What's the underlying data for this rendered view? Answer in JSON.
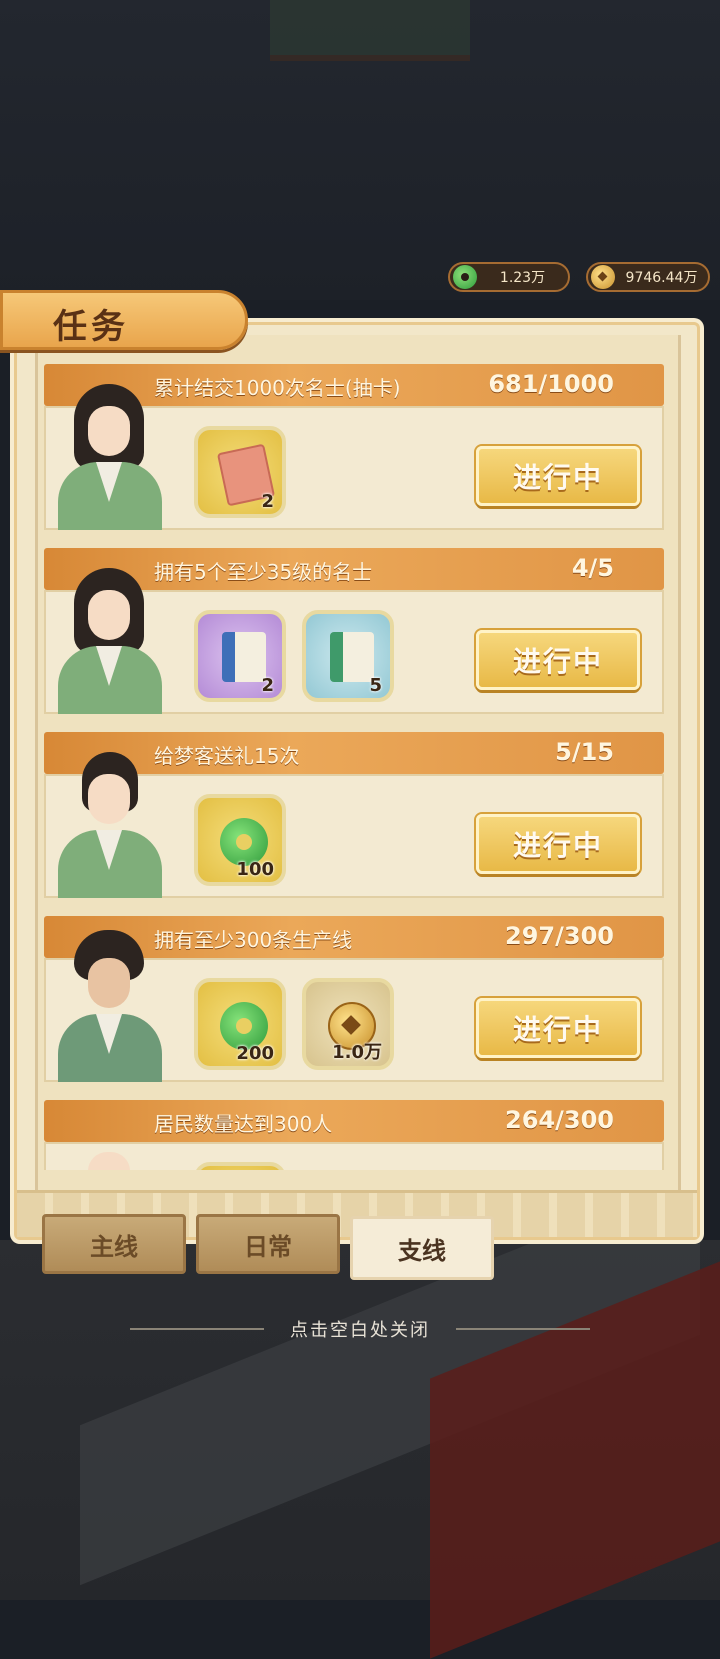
{
  "currency": {
    "jade_icon": "jade-currency-icon",
    "jade_amount": "1.23万",
    "coin_icon": "copper-coin-icon",
    "coin_amount": "9746.44万"
  },
  "panel": {
    "title": "任务"
  },
  "tasks": [
    {
      "name": "累计结交1000次名士(抽卡)",
      "progress": "681/1000",
      "rewards": [
        {
          "icon": "recruit-card-icon",
          "qty": "2"
        }
      ],
      "button": "进行中"
    },
    {
      "name": "拥有5个至少35级的名士",
      "progress": "4/5",
      "rewards": [
        {
          "icon": "blue-scroll-icon",
          "qty": "2"
        },
        {
          "icon": "green-scroll-icon",
          "qty": "5"
        }
      ],
      "button": "进行中"
    },
    {
      "name": "给梦客送礼15次",
      "progress": "5/15",
      "rewards": [
        {
          "icon": "jade-icon",
          "qty": "100"
        }
      ],
      "button": "进行中"
    },
    {
      "name": "拥有至少300条生产线",
      "progress": "297/300",
      "rewards": [
        {
          "icon": "jade-icon",
          "qty": "200"
        },
        {
          "icon": "coin-icon",
          "qty": "1.0万"
        }
      ],
      "button": "进行中"
    },
    {
      "name": "居民数量达到300人",
      "progress": "264/300",
      "rewards": [],
      "button": ""
    }
  ],
  "tabs": [
    "主线",
    "日常",
    "支线"
  ],
  "active_tab": "支线",
  "close_hint": "点击空白处关闭",
  "colors": {
    "panel": "#f2e7c9",
    "header": "#e09546",
    "button": "#e8b947"
  }
}
